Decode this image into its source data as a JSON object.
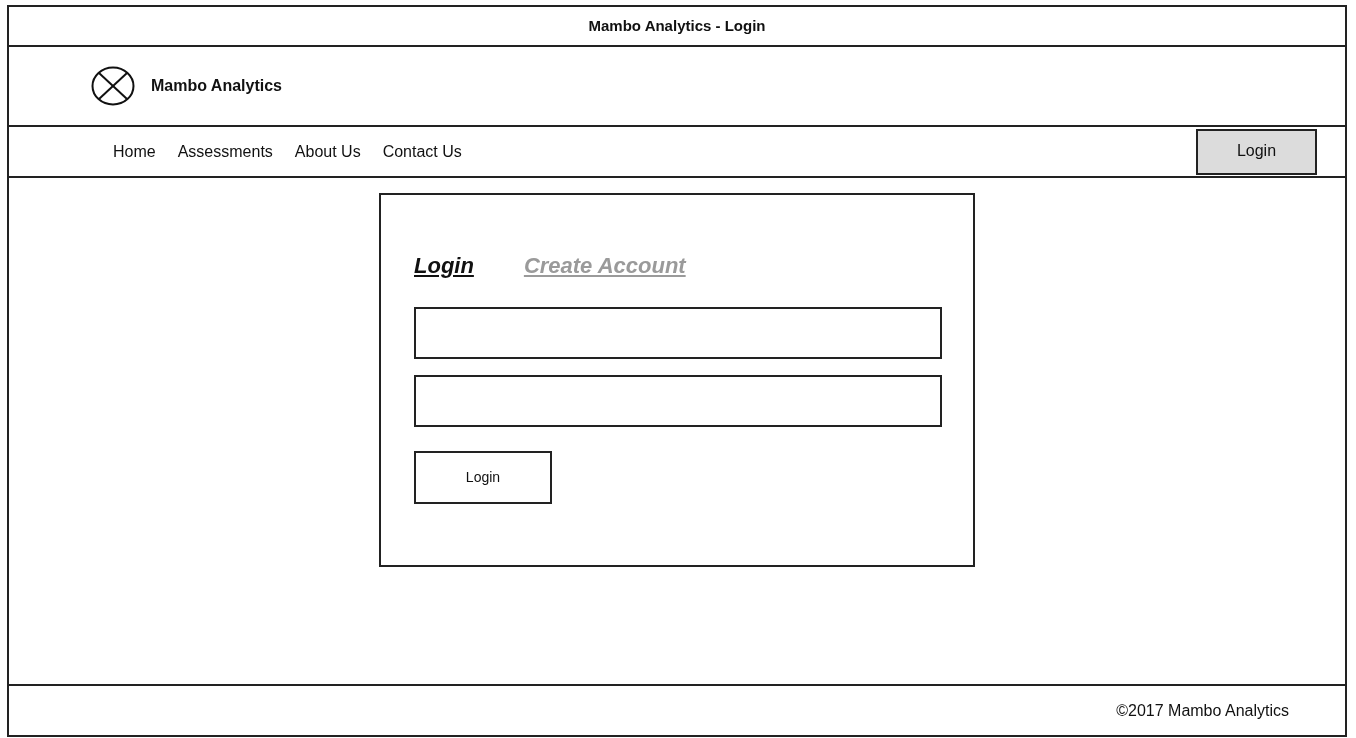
{
  "window": {
    "title": "Mambo Analytics - Login"
  },
  "header": {
    "brand": "Mambo Analytics"
  },
  "nav": {
    "items": [
      {
        "label": "Home"
      },
      {
        "label": "Assessments"
      },
      {
        "label": "About Us"
      },
      {
        "label": "Contact Us"
      }
    ],
    "login_button": "Login"
  },
  "login_card": {
    "tabs": [
      {
        "label": "Login",
        "selected": true
      },
      {
        "label": "Create Account",
        "selected": false
      }
    ],
    "fields": [
      {
        "kind": "text"
      },
      {
        "kind": "text"
      }
    ],
    "submit_button": "Login"
  },
  "footer": {
    "text": "©2017 Mambo Analytics"
  }
}
